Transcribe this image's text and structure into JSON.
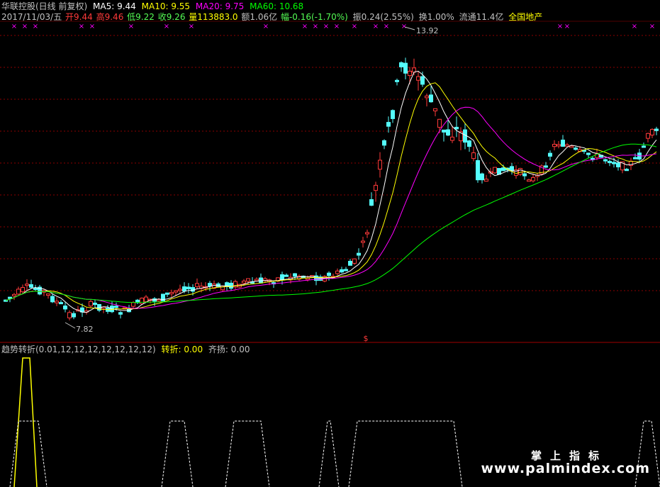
{
  "header": {
    "stock": "华联控股(日线 前复权)",
    "ma5": "MA5: 9.44",
    "ma10": "MA10: 9.55",
    "ma20": "MA20: 9.75",
    "ma60": "MA60: 10.68"
  },
  "quote": {
    "date": "2017/11/03/五",
    "open": "开9.44",
    "high": "高9.46",
    "low": "低9.22",
    "close": "收9.26",
    "volume": "量113883.0",
    "amount": "额1.06亿",
    "change": "幅-0.16(-1.70%)",
    "amplitude": "振0.24(2.55%)",
    "turnover": "换1.00%",
    "float": "流通11.4亿",
    "sector": "全国地产"
  },
  "chart": {
    "high_label": "13.92",
    "low_label": "7.82",
    "dollar_mark": "$"
  },
  "indicator": {
    "name": "趋势转折(0.01,12,12,12,12,12,12,12)",
    "turn": "转折: 0.00",
    "rise": "齐扬: 0.00"
  },
  "watermark": {
    "title": "掌上指标",
    "url": "www.palmindex.com"
  },
  "colors": {
    "up": "#ff3a3a",
    "down": "#54fcfc",
    "ma5": "#ffffff",
    "ma10": "#ffff00",
    "ma20": "#ff00ff",
    "ma60": "#00ff00",
    "marker": "#ff00ff"
  }
}
